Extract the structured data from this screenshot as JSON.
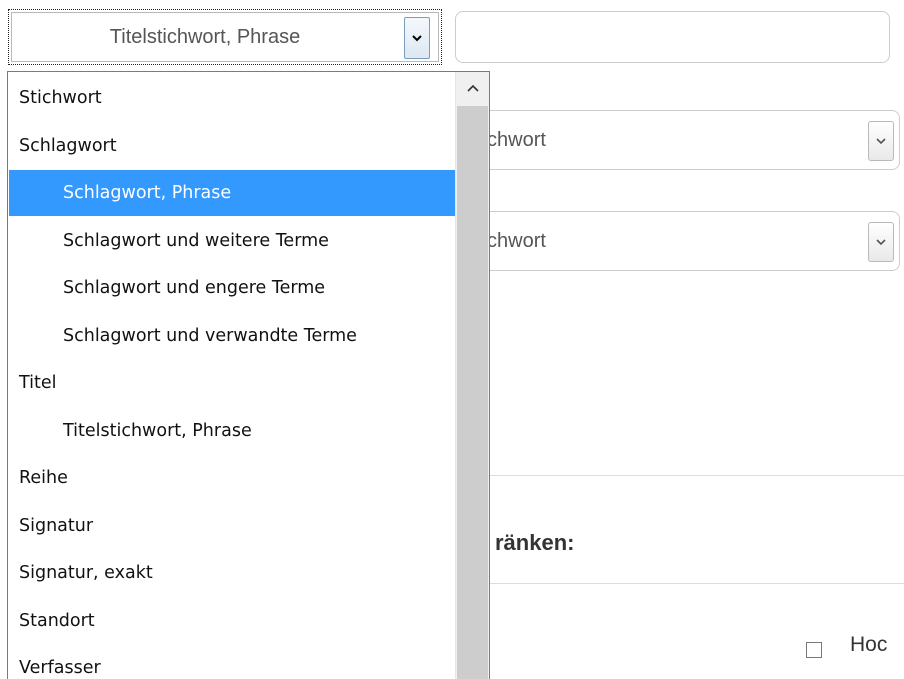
{
  "search_field_select": {
    "value": "Titelstichwort, Phrase"
  },
  "search_input": {
    "value": ""
  },
  "bg_selects": [
    {
      "value_visible": "tichwort"
    },
    {
      "value_visible": "tichwort"
    }
  ],
  "section_heading_visible": "ränken:",
  "checkbox_label_visible": "Hoc",
  "dropdown": {
    "options": [
      {
        "label": "Stichwort",
        "level": 0,
        "selected": false
      },
      {
        "label": "Schlagwort",
        "level": 0,
        "selected": false
      },
      {
        "label": "Schlagwort, Phrase",
        "level": 1,
        "selected": true
      },
      {
        "label": "Schlagwort und weitere Terme",
        "level": 1,
        "selected": false
      },
      {
        "label": "Schlagwort und engere Terme",
        "level": 1,
        "selected": false
      },
      {
        "label": "Schlagwort und verwandte Terme",
        "level": 1,
        "selected": false
      },
      {
        "label": "Titel",
        "level": 0,
        "selected": false
      },
      {
        "label": "Titelstichwort, Phrase",
        "level": 1,
        "selected": false
      },
      {
        "label": "Reihe",
        "level": 0,
        "selected": false
      },
      {
        "label": "Signatur",
        "level": 0,
        "selected": false
      },
      {
        "label": "Signatur, exakt",
        "level": 0,
        "selected": false
      },
      {
        "label": "Standort",
        "level": 0,
        "selected": false
      },
      {
        "label": "Verfasser",
        "level": 0,
        "selected": false
      }
    ]
  },
  "colors": {
    "selection": "#3399ff",
    "scroll_thumb": "#cdcdcd",
    "scroll_track": "#f0f0f0"
  },
  "icons": {
    "dropdown_arrow": "chevron-down-icon",
    "scroll_up": "chevron-up-icon"
  }
}
